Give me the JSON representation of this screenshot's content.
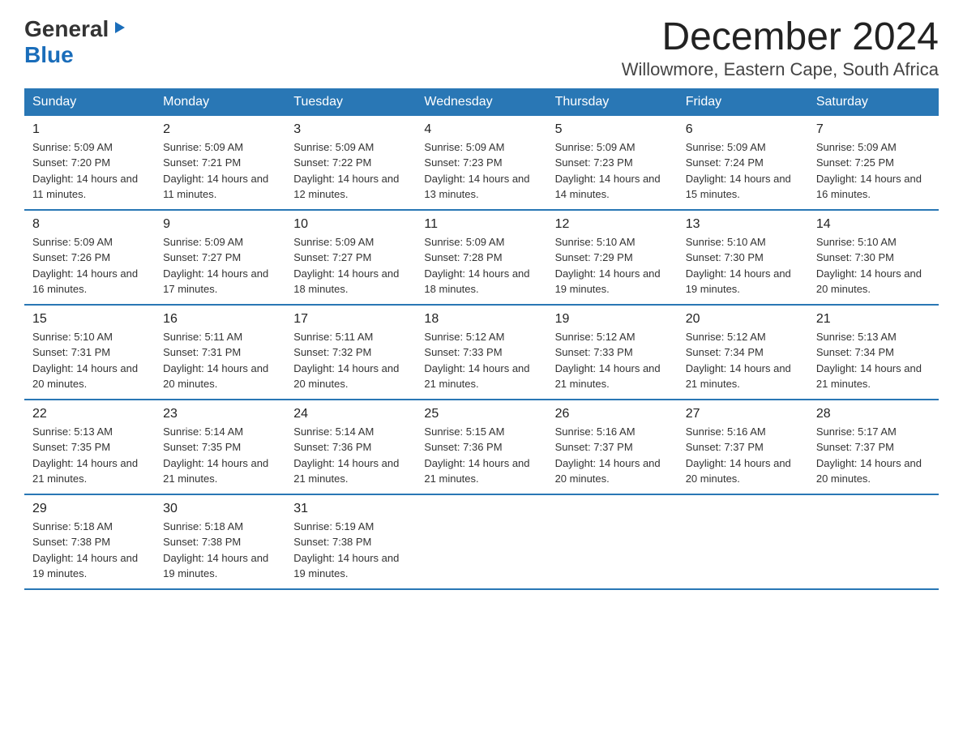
{
  "logo": {
    "general": "General",
    "blue": "Blue",
    "arrow": "▶"
  },
  "title": "December 2024",
  "location": "Willowmore, Eastern Cape, South Africa",
  "days_of_week": [
    "Sunday",
    "Monday",
    "Tuesday",
    "Wednesday",
    "Thursday",
    "Friday",
    "Saturday"
  ],
  "weeks": [
    [
      {
        "day": "1",
        "sunrise": "5:09 AM",
        "sunset": "7:20 PM",
        "daylight": "14 hours and 11 minutes."
      },
      {
        "day": "2",
        "sunrise": "5:09 AM",
        "sunset": "7:21 PM",
        "daylight": "14 hours and 11 minutes."
      },
      {
        "day": "3",
        "sunrise": "5:09 AM",
        "sunset": "7:22 PM",
        "daylight": "14 hours and 12 minutes."
      },
      {
        "day": "4",
        "sunrise": "5:09 AM",
        "sunset": "7:23 PM",
        "daylight": "14 hours and 13 minutes."
      },
      {
        "day": "5",
        "sunrise": "5:09 AM",
        "sunset": "7:23 PM",
        "daylight": "14 hours and 14 minutes."
      },
      {
        "day": "6",
        "sunrise": "5:09 AM",
        "sunset": "7:24 PM",
        "daylight": "14 hours and 15 minutes."
      },
      {
        "day": "7",
        "sunrise": "5:09 AM",
        "sunset": "7:25 PM",
        "daylight": "14 hours and 16 minutes."
      }
    ],
    [
      {
        "day": "8",
        "sunrise": "5:09 AM",
        "sunset": "7:26 PM",
        "daylight": "14 hours and 16 minutes."
      },
      {
        "day": "9",
        "sunrise": "5:09 AM",
        "sunset": "7:27 PM",
        "daylight": "14 hours and 17 minutes."
      },
      {
        "day": "10",
        "sunrise": "5:09 AM",
        "sunset": "7:27 PM",
        "daylight": "14 hours and 18 minutes."
      },
      {
        "day": "11",
        "sunrise": "5:09 AM",
        "sunset": "7:28 PM",
        "daylight": "14 hours and 18 minutes."
      },
      {
        "day": "12",
        "sunrise": "5:10 AM",
        "sunset": "7:29 PM",
        "daylight": "14 hours and 19 minutes."
      },
      {
        "day": "13",
        "sunrise": "5:10 AM",
        "sunset": "7:30 PM",
        "daylight": "14 hours and 19 minutes."
      },
      {
        "day": "14",
        "sunrise": "5:10 AM",
        "sunset": "7:30 PM",
        "daylight": "14 hours and 20 minutes."
      }
    ],
    [
      {
        "day": "15",
        "sunrise": "5:10 AM",
        "sunset": "7:31 PM",
        "daylight": "14 hours and 20 minutes."
      },
      {
        "day": "16",
        "sunrise": "5:11 AM",
        "sunset": "7:31 PM",
        "daylight": "14 hours and 20 minutes."
      },
      {
        "day": "17",
        "sunrise": "5:11 AM",
        "sunset": "7:32 PM",
        "daylight": "14 hours and 20 minutes."
      },
      {
        "day": "18",
        "sunrise": "5:12 AM",
        "sunset": "7:33 PM",
        "daylight": "14 hours and 21 minutes."
      },
      {
        "day": "19",
        "sunrise": "5:12 AM",
        "sunset": "7:33 PM",
        "daylight": "14 hours and 21 minutes."
      },
      {
        "day": "20",
        "sunrise": "5:12 AM",
        "sunset": "7:34 PM",
        "daylight": "14 hours and 21 minutes."
      },
      {
        "day": "21",
        "sunrise": "5:13 AM",
        "sunset": "7:34 PM",
        "daylight": "14 hours and 21 minutes."
      }
    ],
    [
      {
        "day": "22",
        "sunrise": "5:13 AM",
        "sunset": "7:35 PM",
        "daylight": "14 hours and 21 minutes."
      },
      {
        "day": "23",
        "sunrise": "5:14 AM",
        "sunset": "7:35 PM",
        "daylight": "14 hours and 21 minutes."
      },
      {
        "day": "24",
        "sunrise": "5:14 AM",
        "sunset": "7:36 PM",
        "daylight": "14 hours and 21 minutes."
      },
      {
        "day": "25",
        "sunrise": "5:15 AM",
        "sunset": "7:36 PM",
        "daylight": "14 hours and 21 minutes."
      },
      {
        "day": "26",
        "sunrise": "5:16 AM",
        "sunset": "7:37 PM",
        "daylight": "14 hours and 20 minutes."
      },
      {
        "day": "27",
        "sunrise": "5:16 AM",
        "sunset": "7:37 PM",
        "daylight": "14 hours and 20 minutes."
      },
      {
        "day": "28",
        "sunrise": "5:17 AM",
        "sunset": "7:37 PM",
        "daylight": "14 hours and 20 minutes."
      }
    ],
    [
      {
        "day": "29",
        "sunrise": "5:18 AM",
        "sunset": "7:38 PM",
        "daylight": "14 hours and 19 minutes."
      },
      {
        "day": "30",
        "sunrise": "5:18 AM",
        "sunset": "7:38 PM",
        "daylight": "14 hours and 19 minutes."
      },
      {
        "day": "31",
        "sunrise": "5:19 AM",
        "sunset": "7:38 PM",
        "daylight": "14 hours and 19 minutes."
      },
      null,
      null,
      null,
      null
    ]
  ]
}
